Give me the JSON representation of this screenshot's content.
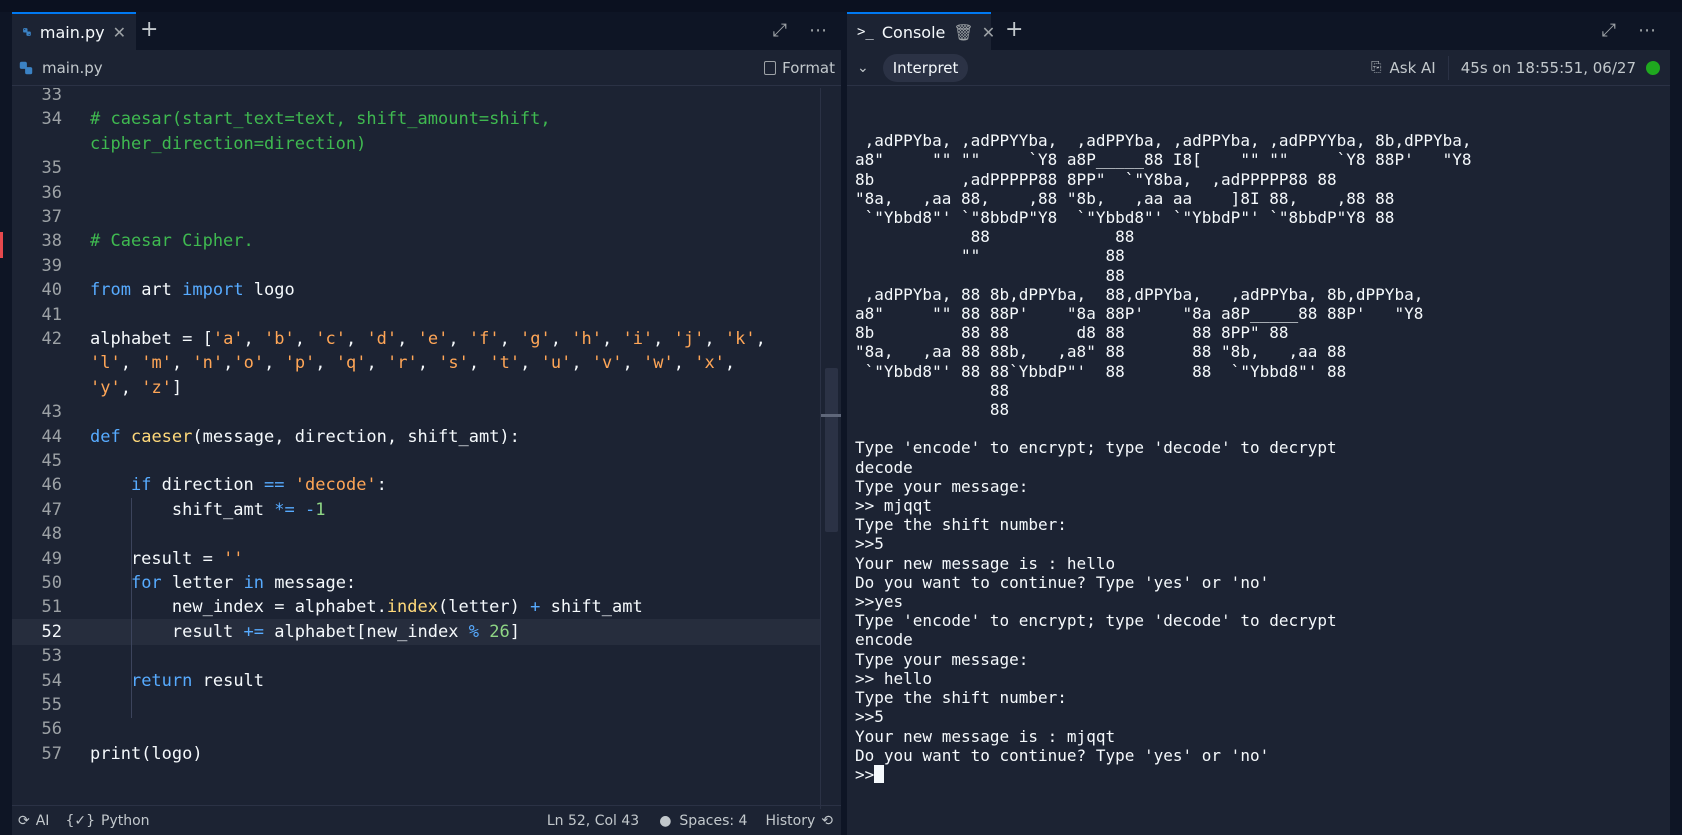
{
  "editor": {
    "tab_title": "main.py",
    "breadcrumb": "main.py",
    "format_label": "Format",
    "status": {
      "ai": "AI",
      "lang": "Python",
      "position": "Ln 52, Col 43",
      "spaces": "Spaces: 4",
      "history": "History"
    },
    "line_numbers": [
      "33",
      "34",
      "",
      "35",
      "36",
      "37",
      "38",
      "39",
      "40",
      "41",
      "42",
      "",
      "",
      "43",
      "44",
      "45",
      "46",
      "47",
      "48",
      "49",
      "50",
      "51",
      "52",
      "53",
      "54",
      "55",
      "56",
      "57"
    ],
    "lines": [
      {
        "n": "33",
        "t": ""
      },
      {
        "n": "34",
        "t": "# caesar(start_text=text, shift_amount=shift,"
      },
      {
        "n": "",
        "t": "cipher_direction=direction)"
      },
      {
        "n": "35",
        "t": ""
      },
      {
        "n": "36",
        "t": ""
      },
      {
        "n": "37",
        "t": ""
      },
      {
        "n": "38",
        "t": "# Caesar Cipher."
      },
      {
        "n": "39",
        "t": ""
      },
      {
        "n": "40",
        "t": "from art import logo"
      },
      {
        "n": "41",
        "t": ""
      },
      {
        "n": "42",
        "t": "alphabet = ['a', 'b', 'c', 'd', 'e', 'f', 'g', 'h', 'i', 'j', 'k',"
      },
      {
        "n": "",
        "t": "'l', 'm', 'n','o', 'p', 'q', 'r', 's', 't', 'u', 'v', 'w', 'x',"
      },
      {
        "n": "",
        "t": "'y', 'z']"
      },
      {
        "n": "43",
        "t": ""
      },
      {
        "n": "44",
        "t": "def caeser(message, direction, shift_amt):"
      },
      {
        "n": "45",
        "t": ""
      },
      {
        "n": "46",
        "t": "    if direction == 'decode':"
      },
      {
        "n": "47",
        "t": "        shift_amt *= -1"
      },
      {
        "n": "48",
        "t": ""
      },
      {
        "n": "49",
        "t": "    result = ''"
      },
      {
        "n": "50",
        "t": "    for letter in message:"
      },
      {
        "n": "51",
        "t": "        new_index = alphabet.index(letter) + shift_amt"
      },
      {
        "n": "52",
        "t": "        result += alphabet[new_index % 26]"
      },
      {
        "n": "53",
        "t": ""
      },
      {
        "n": "54",
        "t": "    return result"
      },
      {
        "n": "55",
        "t": ""
      },
      {
        "n": "56",
        "t": ""
      },
      {
        "n": "57",
        "t": "print(logo)"
      }
    ]
  },
  "console": {
    "tab_title": "Console",
    "interpret_label": "Interpret",
    "ask_ai_label": "Ask AI",
    "run_info": "45s on 18:55:51, 06/27",
    "output": [
      "",
      " ,adPPYba, ,adPPYYba,  ,adPPYba, ,adPPYba, ,adPPYYba, 8b,dPPYba,",
      "a8\"     \"\" \"\"     `Y8 a8P_____88 I8[    \"\" \"\"     `Y8 88P'   \"Y8",
      "8b         ,adPPPPP88 8PP\"  `\"Y8ba,  ,adPPPPP88 88",
      "\"8a,   ,aa 88,    ,88 \"8b,   ,aa aa    ]8I 88,    ,88 88",
      " `\"Ybbd8\"' `\"8bbdP\"Y8  `\"Ybbd8\"' `\"YbbdP\"' `\"8bbdP\"Y8 88",
      "            88             88",
      "           \"\"             88",
      "                          88",
      " ,adPPYba, 88 8b,dPPYba,  88,dPPYba,   ,adPPYba, 8b,dPPYba,",
      "a8\"     \"\" 88 88P'    \"8a 88P'    \"8a a8P_____88 88P'   \"Y8",
      "8b         88 88       d8 88       88 8PP\" 88",
      "\"8a,   ,aa 88 88b,   ,a8\" 88       88 \"8b,   ,aa 88",
      " `\"Ybbd8\"' 88 88`YbbdP\"'  88       88  `\"Ybbd8\"' 88",
      "              88",
      "              88",
      "",
      "Type 'encode' to encrypt; type 'decode' to decrypt",
      "decode",
      "Type your message:",
      ">> mjqqt",
      "Type the shift number:",
      ">>5",
      "Your new message is : hello",
      "Do you want to continue? Type 'yes' or 'no'",
      ">>yes",
      "Type 'encode' to encrypt; type 'decode' to decrypt",
      "encode",
      "Type your message:",
      ">> hello",
      "Type the shift number:",
      ">>5",
      "Your new message is : mjqqt",
      "Do you want to continue? Type 'yes' or 'no'"
    ],
    "prompt": ">>"
  },
  "colors": {
    "bg": "#1c2333",
    "accent": "#0079f2",
    "comment": "#3fb950",
    "keyword": "#57abff",
    "string": "#ffa657",
    "status_green": "#1fa81f"
  }
}
